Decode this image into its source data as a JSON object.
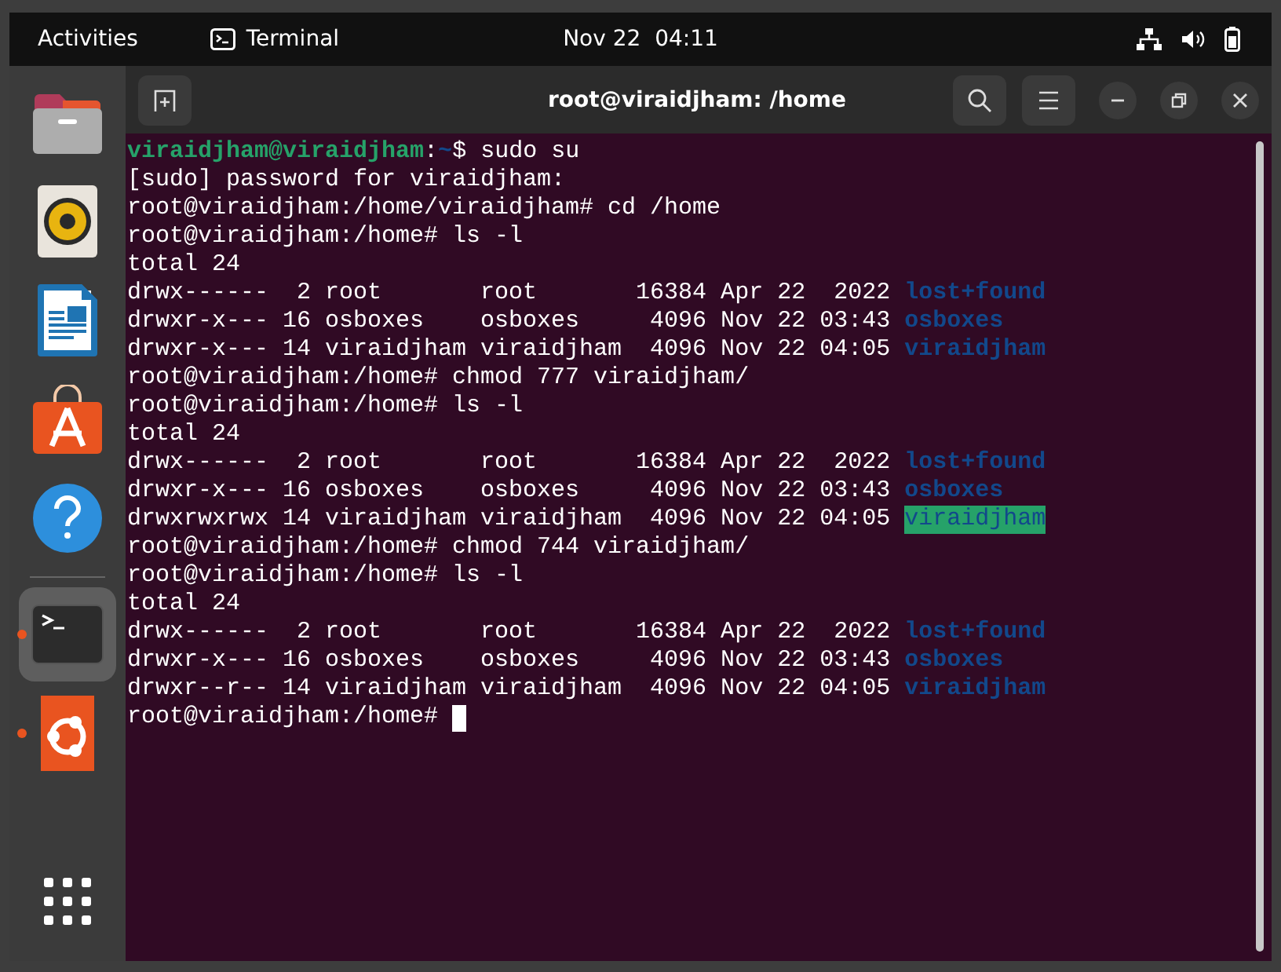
{
  "top_bar": {
    "activities": "Activities",
    "app_name": "Terminal",
    "clock": "Nov 22  04:11"
  },
  "dock": [
    {
      "kind": "files",
      "running": false,
      "selected": false
    },
    {
      "kind": "music",
      "running": false,
      "selected": false
    },
    {
      "kind": "writer",
      "running": false,
      "selected": false
    },
    {
      "kind": "software",
      "running": false,
      "selected": false
    },
    {
      "kind": "help",
      "running": false,
      "selected": false
    },
    {
      "kind": "separator"
    },
    {
      "kind": "terminal",
      "running": true,
      "selected": true
    },
    {
      "kind": "installer",
      "running": true,
      "selected": false
    },
    {
      "kind": "apps",
      "running": false,
      "selected": false
    }
  ],
  "window": {
    "title": "root@viraidjham: /home"
  },
  "terminal": {
    "cursor_visible": true,
    "lines": [
      [
        {
          "text": "viraidjham@viraidjham",
          "kind": "user"
        },
        {
          "text": ":",
          "kind": "plain"
        },
        {
          "text": "~",
          "kind": "path"
        },
        {
          "text": "$ sudo su",
          "kind": "plain"
        }
      ],
      [
        {
          "text": "[sudo] password for viraidjham:",
          "kind": "plain"
        }
      ],
      [
        {
          "text": "root@viraidjham:/home/viraidjham# cd /home",
          "kind": "plain"
        }
      ],
      [
        {
          "text": "root@viraidjham:/home# ls -l",
          "kind": "plain"
        }
      ],
      [
        {
          "text": "total 24",
          "kind": "plain"
        }
      ],
      [
        {
          "text": "drwx------  2 root       root       16384 Apr 22  2022 ",
          "kind": "plain"
        },
        {
          "text": "lost+found",
          "kind": "dir"
        }
      ],
      [
        {
          "text": "drwxr-x--- 16 osboxes    osboxes     4096 Nov 22 03:43 ",
          "kind": "plain"
        },
        {
          "text": "osboxes",
          "kind": "dir"
        }
      ],
      [
        {
          "text": "drwxr-x--- 14 viraidjham viraidjham  4096 Nov 22 04:05 ",
          "kind": "plain"
        },
        {
          "text": "viraidjham",
          "kind": "dir"
        }
      ],
      [
        {
          "text": "root@viraidjham:/home# chmod 777 viraidjham/",
          "kind": "plain"
        }
      ],
      [
        {
          "text": "root@viraidjham:/home# ls -l",
          "kind": "plain"
        }
      ],
      [
        {
          "text": "total 24",
          "kind": "plain"
        }
      ],
      [
        {
          "text": "drwx------  2 root       root       16384 Apr 22  2022 ",
          "kind": "plain"
        },
        {
          "text": "lost+found",
          "kind": "dir"
        }
      ],
      [
        {
          "text": "drwxr-x--- 16 osboxes    osboxes     4096 Nov 22 03:43 ",
          "kind": "plain"
        },
        {
          "text": "osboxes",
          "kind": "dir"
        }
      ],
      [
        {
          "text": "drwxrwxrwx 14 viraidjham viraidjham  4096 Nov 22 04:05 ",
          "kind": "plain"
        },
        {
          "text": "viraidjham",
          "kind": "dir-writable"
        }
      ],
      [
        {
          "text": "root@viraidjham:/home# chmod 744 viraidjham/",
          "kind": "plain"
        }
      ],
      [
        {
          "text": "root@viraidjham:/home# ls -l",
          "kind": "plain"
        }
      ],
      [
        {
          "text": "total 24",
          "kind": "plain"
        }
      ],
      [
        {
          "text": "drwx------  2 root       root       16384 Apr 22  2022 ",
          "kind": "plain"
        },
        {
          "text": "lost+found",
          "kind": "dir"
        }
      ],
      [
        {
          "text": "drwxr-x--- 16 osboxes    osboxes     4096 Nov 22 03:43 ",
          "kind": "plain"
        },
        {
          "text": "osboxes",
          "kind": "dir"
        }
      ],
      [
        {
          "text": "drwxr--r-- 14 viraidjham viraidjham  4096 Nov 22 04:05 ",
          "kind": "plain"
        },
        {
          "text": "viraidjham",
          "kind": "dir"
        }
      ],
      [
        {
          "text": "root@viraidjham:/home# ",
          "kind": "plain"
        }
      ]
    ]
  }
}
